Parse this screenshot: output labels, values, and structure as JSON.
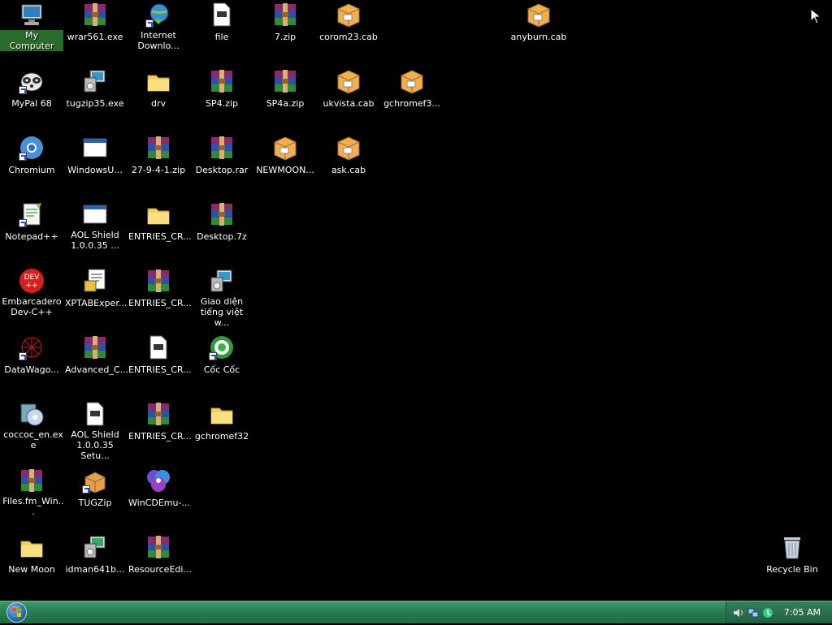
{
  "desktop": {
    "icons": [
      {
        "label": "My Computer"
      },
      {
        "label": "MyPal 68"
      },
      {
        "label": "Chromium"
      },
      {
        "label": "Notepad++"
      },
      {
        "label": "Embarcadero Dev-C++"
      },
      {
        "label": "DataWago..."
      },
      {
        "label": "coccoc_en.exe"
      },
      {
        "label": "Files.fm_Win..."
      },
      {
        "label": "New Moon"
      },
      {
        "label": "wrar561.exe"
      },
      {
        "label": "tugzip35.exe"
      },
      {
        "label": "WindowsU..."
      },
      {
        "label": "AOL Shield 1.0.0.35 ..."
      },
      {
        "label": "XPTABExper..."
      },
      {
        "label": "Advanced_C..."
      },
      {
        "label": "AOL Shield 1.0.0.35 Setu..."
      },
      {
        "label": "TUGZip"
      },
      {
        "label": "idman641b..."
      },
      {
        "label": "Internet Downlo..."
      },
      {
        "label": "drv"
      },
      {
        "label": "27-9-4-1.zip"
      },
      {
        "label": "ENTRIES_CR..."
      },
      {
        "label": "ENTRIES_CR..."
      },
      {
        "label": "ENTRIES_CR..."
      },
      {
        "label": "ENTRIES_CR..."
      },
      {
        "label": "WinCDEmu-..."
      },
      {
        "label": "ResourceEdi..."
      },
      {
        "label": "file"
      },
      {
        "label": "SP4.zip"
      },
      {
        "label": "Desktop.rar"
      },
      {
        "label": "Desktop.7z"
      },
      {
        "label": "Giao diện tiếng việt w..."
      },
      {
        "label": "Cốc Cốc"
      },
      {
        "label": "gchromef32"
      },
      {
        "label": "7.zip"
      },
      {
        "label": "SP4a.zip"
      },
      {
        "label": "NEWMOON..."
      },
      {
        "label": "corom23.cab"
      },
      {
        "label": "ukvista.cab"
      },
      {
        "label": "ask.cab"
      },
      {
        "label": "gchromef3..."
      },
      {
        "label": "anyburn.cab"
      },
      {
        "label": "Recycle Bin"
      }
    ]
  },
  "taskbar": {
    "clock": "7:05 AM",
    "tray_icons": [
      "speaker-icon",
      "network-icon",
      "update-icon"
    ]
  }
}
